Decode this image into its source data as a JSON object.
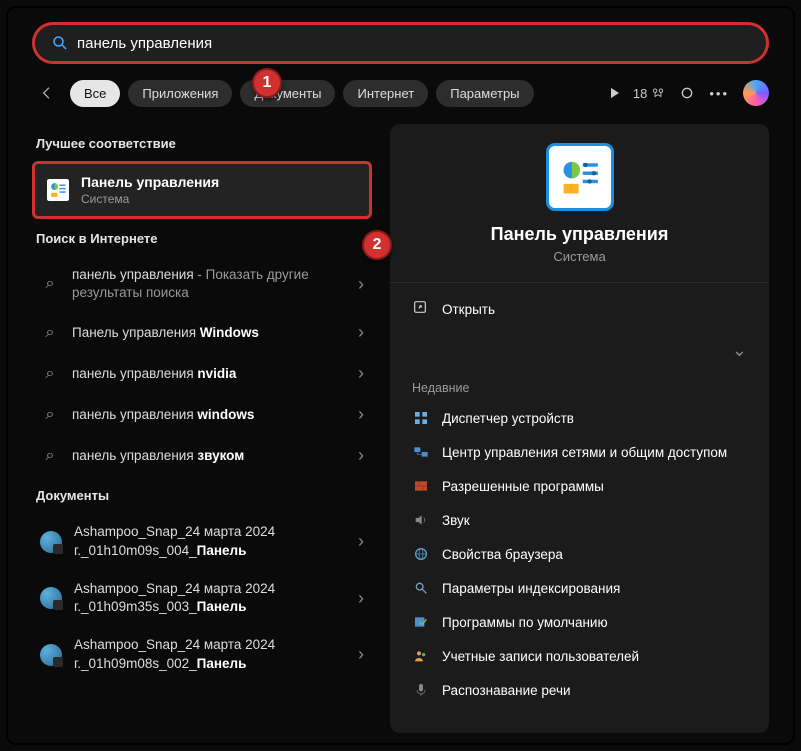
{
  "search": {
    "query": "панель управления"
  },
  "filters": {
    "items": [
      "Все",
      "Приложения",
      "Документы",
      "Интернет",
      "Параметры"
    ],
    "score": "18"
  },
  "badges": {
    "b1": "1",
    "b2": "2"
  },
  "left": {
    "best_header": "Лучшее соответствие",
    "best": {
      "title": "Панель управления",
      "sub": "Система"
    },
    "web_header": "Поиск в Интернете",
    "web": [
      {
        "prefix": "панель управления",
        "suffix": " - Показать другие результаты поиска",
        "bold": ""
      },
      {
        "prefix": "Панель управления ",
        "bold": "Windows",
        "suffix": ""
      },
      {
        "prefix": "панель управления ",
        "bold": "nvidia",
        "suffix": ""
      },
      {
        "prefix": "панель управления ",
        "bold": "windows",
        "suffix": ""
      },
      {
        "prefix": "панель управления ",
        "bold": "звуком",
        "suffix": ""
      }
    ],
    "docs_header": "Документы",
    "docs": [
      {
        "l1": "Ashampoo_Snap_24 марта 2024",
        "l2": "г._01h10m09s_004_",
        "bold": "Панель"
      },
      {
        "l1": "Ashampoo_Snap_24 марта 2024",
        "l2": "г._01h09m35s_003_",
        "bold": "Панель"
      },
      {
        "l1": "Ashampoo_Snap_24 марта 2024",
        "l2": "г._01h09m08s_002_",
        "bold": "Панель"
      }
    ]
  },
  "right": {
    "title": "Панель управления",
    "sub": "Система",
    "open": "Открыть",
    "recent_header": "Недавние",
    "recent": [
      "Диспетчер устройств",
      "Центр управления сетями и общим доступом",
      "Разрешенные программы",
      "Звук",
      "Свойства браузера",
      "Параметры индексирования",
      "Программы по умолчанию",
      "Учетные записи пользователей",
      "Распознавание речи"
    ]
  }
}
